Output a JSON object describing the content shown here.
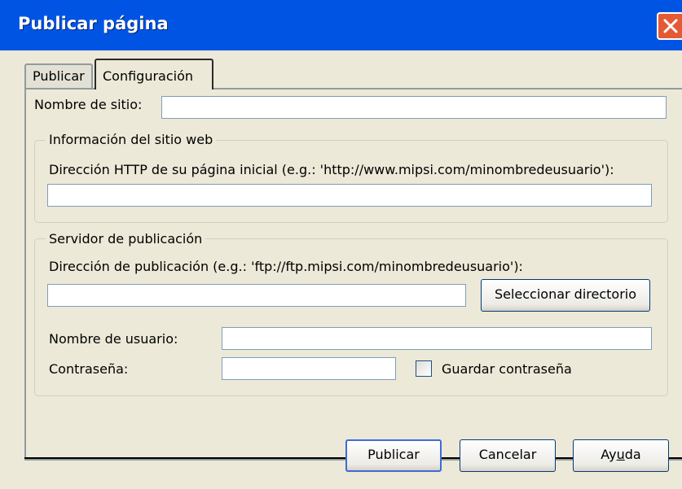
{
  "window": {
    "title": "Publicar página"
  },
  "tabs": [
    {
      "label": "Publicar"
    },
    {
      "label": "Configuración"
    }
  ],
  "site": {
    "name_label": "Nombre de sitio:",
    "name_value": ""
  },
  "web_info": {
    "legend": "Información del sitio web",
    "http_label": "Dirección HTTP de su página inicial (e.g.: 'http://www.mipsi.com/minombredeusuario'):",
    "http_value": ""
  },
  "server": {
    "legend": "Servidor de publicación",
    "address_label": "Dirección de publicación (e.g.: 'ftp://ftp.mipsi.com/minombredeusuario'):",
    "address_value": "",
    "select_dir_label": "Seleccionar directorio",
    "username_label": "Nombre de usuario:",
    "username_value": "",
    "password_label": "Contraseña:",
    "password_value": "",
    "save_password_label": "Guardar contraseña",
    "save_password_checked": false
  },
  "buttons": {
    "publish": "Publicar",
    "cancel": "Cancelar",
    "help_prefix": "Ay",
    "help_accel": "u",
    "help_suffix": "da"
  },
  "colors": {
    "titlebar": "#0054E3",
    "close": "#E45A34",
    "face": "#ECE9D8"
  },
  "icons": {
    "close": "close-icon"
  }
}
